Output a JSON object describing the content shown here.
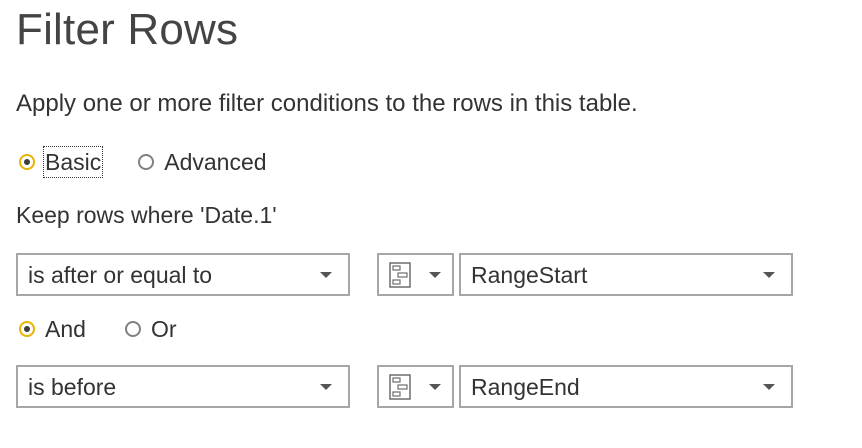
{
  "dialog": {
    "title": "Filter Rows",
    "description": "Apply one or more filter conditions to the rows in this table."
  },
  "mode": {
    "options": [
      {
        "label": "Basic",
        "selected": true
      },
      {
        "label": "Advanced",
        "selected": false
      }
    ]
  },
  "keep_label": "Keep rows where 'Date.1'",
  "conditions": [
    {
      "operator": "is after or equal to",
      "value_type_icon": "parameter-icon",
      "value": "RangeStart"
    },
    {
      "operator": "is before",
      "value_type_icon": "parameter-icon",
      "value": "RangeEnd"
    }
  ],
  "logic": {
    "options": [
      {
        "label": "And",
        "selected": true
      },
      {
        "label": "Or",
        "selected": false
      }
    ]
  },
  "colors": {
    "accent_radio_ring": "#e8b400",
    "border": "#a6a6a6",
    "text": "#333333"
  }
}
